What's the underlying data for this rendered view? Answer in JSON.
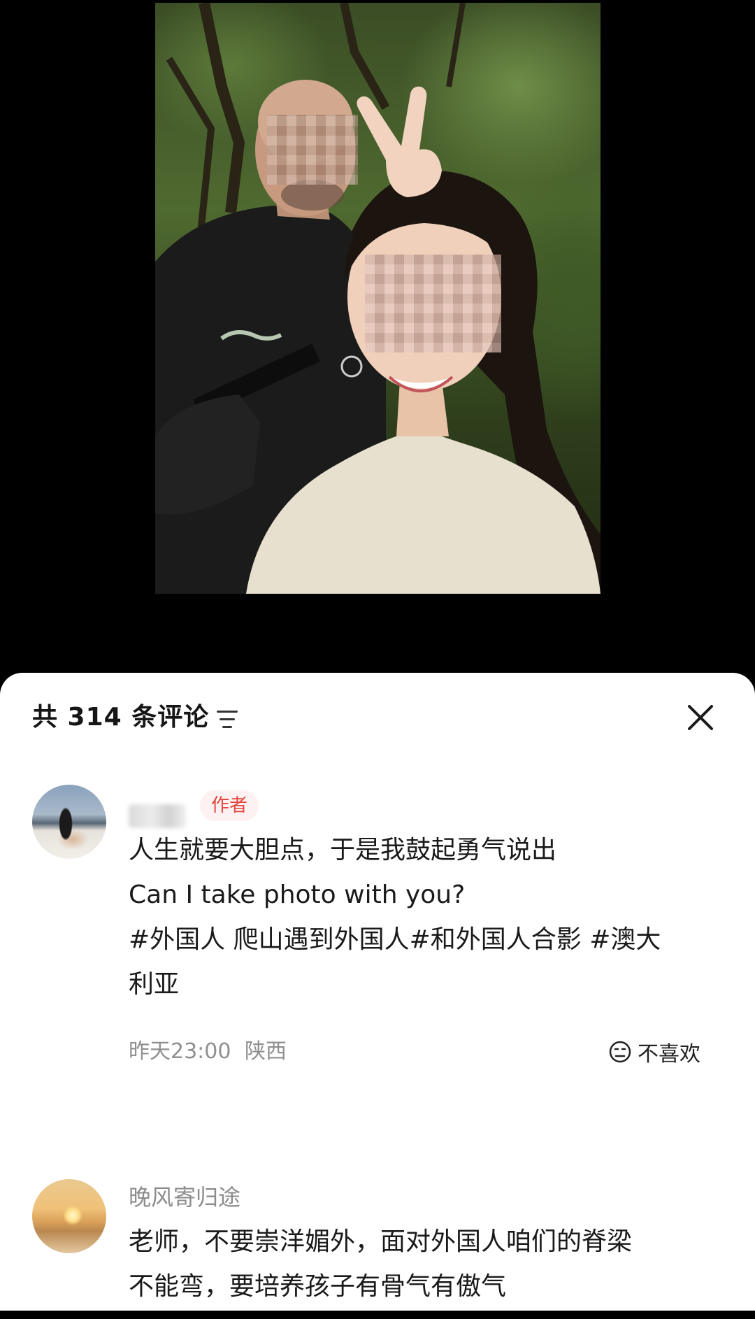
{
  "comments_panel": {
    "count_text": "共 314 条评论"
  },
  "comments": [
    {
      "badge": "作者",
      "lines": [
        "人生就要大胆点，于是我鼓起勇气说出",
        "Can I take photo with you?",
        "#外国人 爬山遇到外国人#和外国人合影 #澳大",
        "利亚"
      ],
      "time": "昨天23:00",
      "location": "陕西",
      "dislike_label": "不喜欢"
    },
    {
      "username": "晚风寄归途",
      "lines": [
        "老师，不要崇洋媚外，面对外国人咱们的脊梁",
        "不能弯，要培养孩子有骨气有傲气"
      ]
    }
  ],
  "colors": {
    "badge_text": "#e3463f",
    "badge_bg": "#fdf1f1",
    "meta_text": "#8f8f8f"
  },
  "icons": [
    "filter-icon",
    "close-icon",
    "dislike-face-icon"
  ]
}
